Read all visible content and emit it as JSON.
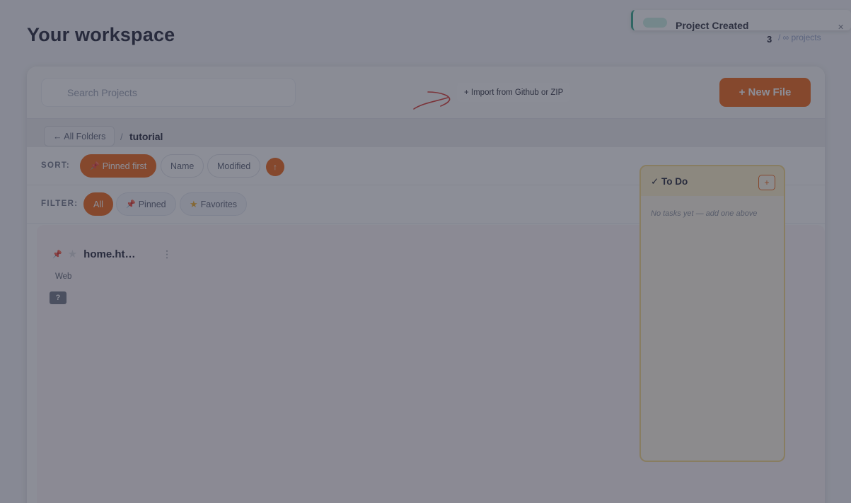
{
  "workspace": {
    "title": "Your workspace",
    "project_count": "3",
    "project_count_label": "/ ∞ projects"
  },
  "toast": {
    "title": "Project Created",
    "close_icon": "close-icon"
  },
  "toolbar": {
    "search_placeholder": "Search Projects",
    "import_label": "+ Import from Github or ZIP",
    "new_file_label": "+ New File"
  },
  "breadcrumb": {
    "back_label": "← All Folders",
    "separator": "/",
    "current": "tutorial"
  },
  "sort": {
    "label": "SORT:",
    "options": [
      "Pinned first",
      "Name",
      "Modified"
    ],
    "active": "Pinned first",
    "direction_icon": "↑"
  },
  "filter": {
    "label": "FILTER:",
    "options": [
      "All",
      "Pinned",
      "Favorites"
    ],
    "active": "All"
  },
  "files": [
    {
      "name": "home.ht…",
      "tag": "Web",
      "badge": "?",
      "pinned": true,
      "favorite": false
    }
  ],
  "todo": {
    "title": "✓ To Do",
    "add_label": "+",
    "empty_text": "No tasks yet — add one above"
  },
  "colors": {
    "accent": "#f0600f",
    "toast_accent": "#2fa58a",
    "todo_background": "#fff9e8"
  }
}
